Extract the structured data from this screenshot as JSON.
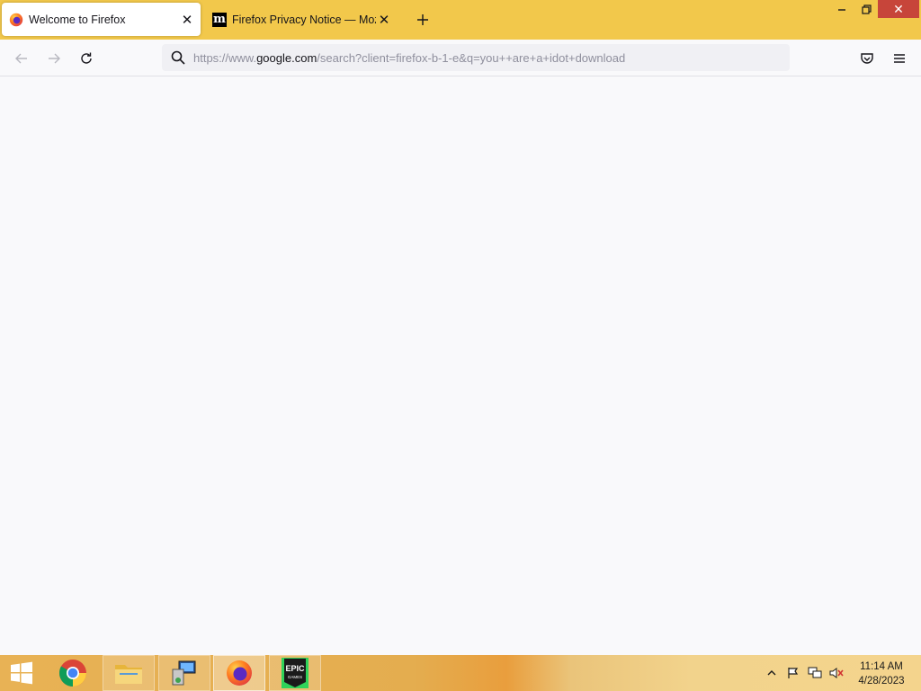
{
  "browser": {
    "tabs": [
      {
        "title": "Welcome to Firefox",
        "active": true
      },
      {
        "title": "Firefox Privacy Notice — Mozilla",
        "active": false
      }
    ],
    "favicon_letter": "m"
  },
  "urlbar": {
    "prefix": "https://www.",
    "host": "google.com",
    "path": "/search?client=firefox-b-1-e&q=you++are+a+idot+download"
  },
  "taskbar": {
    "items": [
      "start-button",
      "chrome",
      "file-explorer",
      "remote-desktop",
      "firefox",
      "epic-games"
    ],
    "epic_label_top": "EPIC",
    "epic_label_bottom": "GAMES"
  },
  "clock": {
    "time": "11:14 AM",
    "date": "4/28/2023"
  },
  "colors": {
    "tabstrip": "#f2c84b",
    "close_button": "#c7453a",
    "content_bg": "#f9f9fb"
  }
}
